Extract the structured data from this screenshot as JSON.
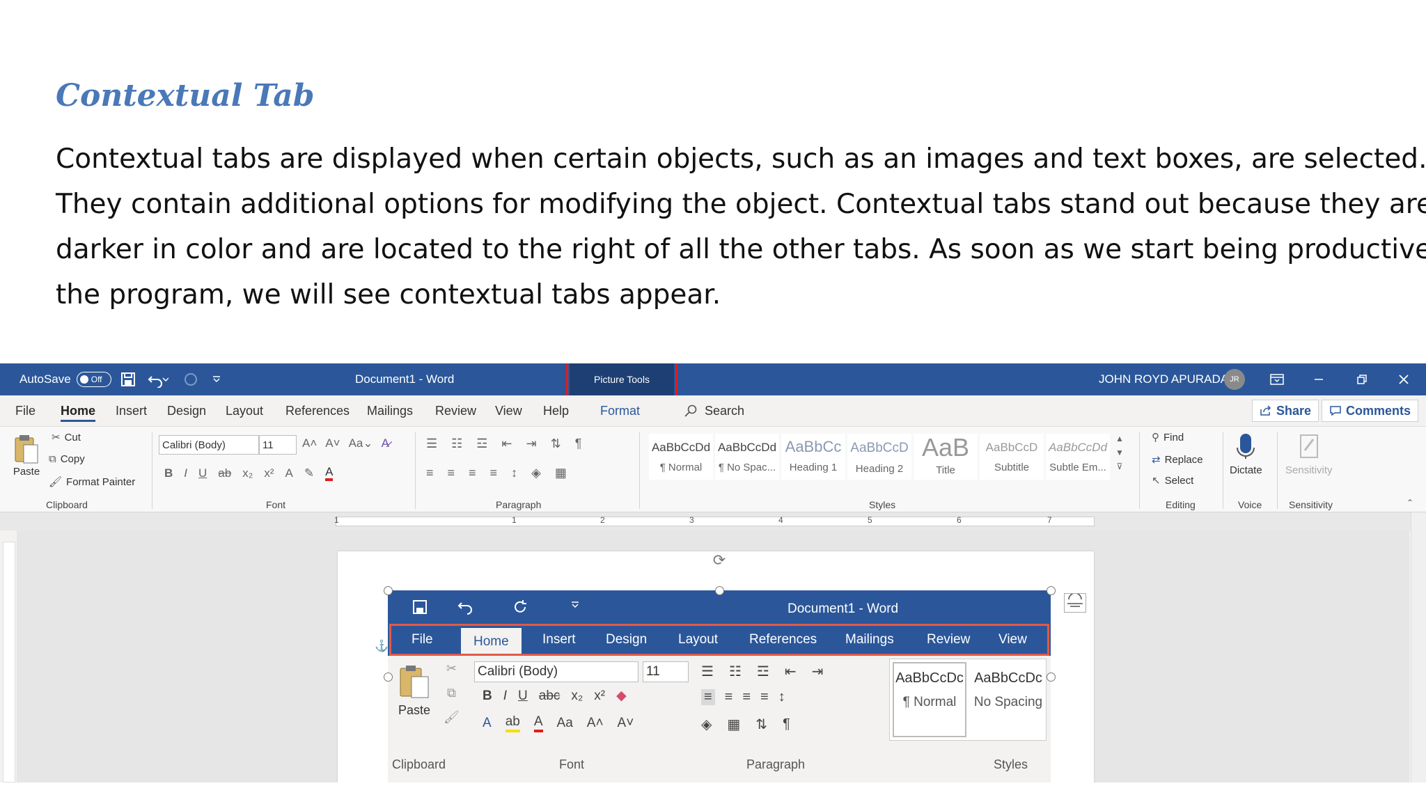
{
  "slide": {
    "title": "Contextual Tab",
    "lines": [
      "Contextual tabs are displayed when certain objects, such as an images and text boxes, are selected.",
      "They contain additional options for modifying the object.  Contextual tabs stand out because they are",
      "darker in color and are located to the right of all the other tabs. As soon as we start being productive in",
      "the program, we will see contextual tabs appear."
    ]
  },
  "word": {
    "autosave_label": "AutoSave",
    "autosave_state": "Off",
    "doc_title": "Document1  -  Word",
    "contextual_group": "Picture Tools",
    "user_name": "JOHN ROYD APURADA",
    "user_initials": "JR",
    "tabs": [
      "File",
      "Home",
      "Insert",
      "Design",
      "Layout",
      "References",
      "Mailings",
      "Review",
      "View",
      "Help",
      "Format"
    ],
    "search_label": "Search",
    "share_label": "Share",
    "comments_label": "Comments",
    "clipboard": {
      "paste": "Paste",
      "cut": "Cut",
      "copy": "Copy",
      "format_painter": "Format Painter",
      "label": "Clipboard"
    },
    "font": {
      "name": "Calibri (Body)",
      "size": "11",
      "label": "Font"
    },
    "paragraph_label": "Paragraph",
    "styles": {
      "label": "Styles",
      "items": [
        {
          "preview": "AaBbCcDd",
          "name": "¶ Normal"
        },
        {
          "preview": "AaBbCcDd",
          "name": "¶ No Spac..."
        },
        {
          "preview": "AaBbCc",
          "name": "Heading 1"
        },
        {
          "preview": "AaBbCcD",
          "name": "Heading 2"
        },
        {
          "preview": "AaB",
          "name": "Title"
        },
        {
          "preview": "AaBbCcD",
          "name": "Subtitle"
        },
        {
          "preview": "AaBbCcDd",
          "name": "Subtle Em..."
        }
      ]
    },
    "editing": {
      "find": "Find",
      "replace": "Replace",
      "select": "Select",
      "label": "Editing"
    },
    "voice": {
      "dictate": "Dictate",
      "label": "Voice"
    },
    "sensitivity": {
      "button": "Sensitivity",
      "label": "Sensitivity"
    },
    "ruler_numbers": [
      "1",
      "1",
      "2",
      "3",
      "4",
      "5",
      "6",
      "7"
    ]
  },
  "picture": {
    "title": "Document1 - Word",
    "tabs": [
      "File",
      "Home",
      "Insert",
      "Design",
      "Layout",
      "References",
      "Mailings",
      "Review",
      "View"
    ],
    "font_name": "Calibri (Body)",
    "font_size": "11",
    "paste": "Paste",
    "clipboard_label": "Clipboard",
    "font_label": "Font",
    "paragraph_label": "Paragraph",
    "styles_label": "Styles",
    "styles": [
      {
        "preview": "AaBbCcDc",
        "name": "¶ Normal"
      },
      {
        "preview": "AaBbCcDc",
        "name": "No Spacing"
      }
    ]
  },
  "colors": {
    "word_blue": "#2b579a",
    "contextual_dark": "#1e3f73",
    "highlight_red": "#e31b1b",
    "title_blue": "#4a78b8"
  }
}
